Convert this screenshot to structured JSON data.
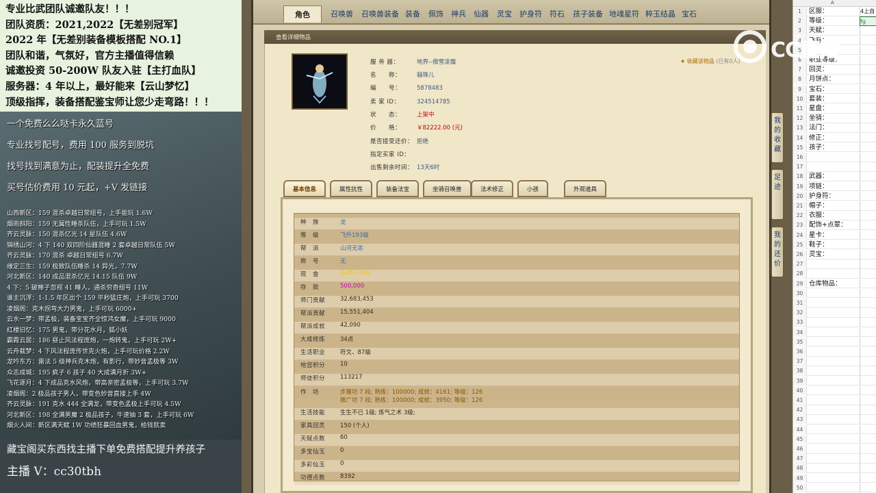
{
  "left_overlay": {
    "top_lines": [
      "专业比武团队诚邀队友！！！",
      "团队资质：2021,2022【无差别冠军】",
      "2022 年【无差别装备模板搭配 NO.1】",
      "团队和谐，气氛好，官方主播值得信赖",
      "诚邀投资 50-200W 队友入驻【主打血队】",
      "服务器：4 年以上，最好能来【云山梦忆】",
      "顶级指挥，装备搭配鉴宝师让您少走弯路！！！"
    ],
    "service_lines": [
      "一个免费么么哒卡永久蓝号",
      "专业找号配号，费用 100 服务到脱坑",
      "找号找到满意为止，配装提升全免费",
      "买号估价费用 10 元起，+V 发链接"
    ],
    "list_lines": [
      "山西新区：159 混杀卓越日常组号，上手能玩 1.6W",
      "烟雨斜阳：159 无属性睡杀队伍，上手可玩 1.5W",
      "齐云灵脉：150 混杀亿光 14 星队伍 4.6W",
      "锦绣山河：4 下 140 双四阶仙器混睡 2 套卓越日常队伍 5W",
      "齐云灵脉：170 混杀 卓越日常组号 6.7W",
      "缘定三生：159 极致队伍睡杀 14 异光，7.7W",
      "河北新区：140 成品混杀亿光 14.15 队伍 9W",
      "4 下：5 破棒子忽视 41 睡人，通杀穷奇组号 11W",
      "谁主沉浮：1-1.5 年区出个 159 平秒猛庄炮，上手可玩 3700",
      "凌烟阁：克木拐弯大力男鬼，上手可玩 6000+",
      "云水一梦：带孟极，装备宝宝齐全惊鸿女魔，上手可玩 9000",
      "红楼旧忆：175 男鬼，带分花水月，狐小妖",
      "霸霞云居：186 昼止风法程庞炮，一炮转鬼，上手可玩 2W+",
      "云舟载梦：4 下风法程庞传世克火炮，上手可玩价格 2.2W",
      "龙吟东方：雷法 5 级神兵克木炮，有影行，带妙音孟极等 3W",
      "众志成城：195 疯子 6 孩子 40 大成满月折 3W+",
      "飞花逐月：4 下成品克水风炮，带高亲密孟极等，上手可玩 3.7W",
      "凌烟阁：2 极品孩子男人，带变色妙音直接上手 4W",
      "齐云灵脉：191 克水 444 全满龙，带变色孟极上手可玩 4.5W",
      "河北新区：198 全满男魔 2 极品孩子，牛速抽 3 套，上手可玩 6W",
      "烟火人间：新区满天赋 1W 功绩狂暴回血男鬼，给钱就卖"
    ],
    "bottom_line": "藏宝阁买东西找主播下单免费搭配提升养孩子",
    "anchor_line": "主播 V：cc30tbh"
  },
  "game": {
    "tabs": [
      "角色",
      "召唤兽",
      "召唤兽装备",
      "装备",
      "佩饰",
      "神兵",
      "仙器",
      "灵宝",
      "护身符",
      "符石",
      "孩子装备",
      "地魂星符",
      "粹玉结晶",
      "宝石"
    ],
    "active_tab": "角色",
    "section_title": "查看详细物品",
    "favorite_label": "收藏该物品",
    "favorite_count": "(已有0人)",
    "item_info": [
      {
        "key": "服 务 器：",
        "value": "地界--傲雪凌霜"
      },
      {
        "key": "名　　称：",
        "value": "骊珠儿"
      },
      {
        "key": "编　　号：",
        "value": "5878483"
      },
      {
        "key": "卖 家 ID：",
        "value": "324514785"
      },
      {
        "key": "状　　态：",
        "value": "上架中"
      },
      {
        "key": "价　　格：",
        "value": "￥82222.00 (元)"
      },
      {
        "key": "是否接受还价：",
        "value": "拒绝"
      },
      {
        "key": "指定买家 ID：",
        "value": ""
      },
      {
        "key": "出售剩余时间：",
        "value": "13天6时"
      }
    ],
    "info_tabs": [
      "基本信息",
      "属性抗性",
      "装备法宝",
      "坐骑召唤兽",
      "法术修正",
      "小孩",
      "外观道具"
    ],
    "active_info_tab": "基本信息",
    "details": [
      {
        "key": "种　族",
        "value": "龙",
        "color": "#3a6fa0"
      },
      {
        "key": "等　级",
        "value": "飞升193级",
        "color": "#3a6fa0"
      },
      {
        "key": "帮　派",
        "value": "山河无恙",
        "color": "#3a6fa0"
      },
      {
        "key": "称　号",
        "value": "无",
        "color": "#3a6fa0"
      },
      {
        "key": "现　金",
        "value": "2,457,646",
        "color": "#f5c400"
      },
      {
        "key": "存　款",
        "value": "500,000",
        "color": "#d000b0"
      },
      {
        "key": "师门贡献",
        "value": "32,683,453",
        "color": "#3a2a14"
      },
      {
        "key": "帮派贡献",
        "value": "15,551,404",
        "color": "#3a2a14"
      },
      {
        "key": "帮派成就",
        "value": "42,090",
        "color": "#3a2a14"
      },
      {
        "key": "大成修炼",
        "value": "34点",
        "color": "#3a2a14"
      },
      {
        "key": "生活职业",
        "value": "符文、87级",
        "color": "#3a2a14"
      },
      {
        "key": "地宫积分",
        "value": "10",
        "color": "#3a2a14"
      },
      {
        "key": "师徒积分",
        "value": "113217",
        "color": "#3a2a14"
      },
      {
        "key": "生活技能",
        "value": "生生不已 1级; 炼气之术 3级;",
        "color": "#3a2a14"
      },
      {
        "key": "家具回灵",
        "value": "150 (个人)",
        "color": "#3a2a14"
      },
      {
        "key": "天赋点数",
        "value": "60",
        "color": "#3a2a14"
      },
      {
        "key": "多宝仙玉",
        "value": "0",
        "color": "#3a2a14"
      },
      {
        "key": "多彩仙玉",
        "value": "0",
        "color": "#3a2a14"
      },
      {
        "key": "功德点数",
        "value": "8392",
        "color": "#3a2a14"
      }
    ],
    "workshop_key": "作　坊",
    "workshop_lines": [
      "步履坊 7 段; 熟练：100000; 成就：4161; 等级：126",
      "推广坊 7 段; 熟练：100000; 成就：3950; 等级：126"
    ],
    "side_buttons": [
      "我的收藏",
      "足迹",
      "我的还价"
    ]
  },
  "logo": {
    "text": "CC直播"
  },
  "sheet": {
    "column": "A",
    "rows": [
      {
        "n": "1",
        "t": "区服：",
        "c2": "4上自"
      },
      {
        "n": "2",
        "t": "等级：",
        "c2": "fg"
      },
      {
        "n": "3",
        "t": "天赋：",
        "c2": ""
      },
      {
        "n": "4",
        "t": "飞升：",
        "c2": ""
      },
      {
        "n": "5",
        "t": "",
        "c2": ""
      },
      {
        "n": "6",
        "t": "职业等级：",
        "c2": ""
      },
      {
        "n": "7",
        "t": "回灵：",
        "c2": ""
      },
      {
        "n": "8",
        "t": "月饼点：",
        "c2": ""
      },
      {
        "n": "9",
        "t": "宝石：",
        "c2": ""
      },
      {
        "n": "10",
        "t": "套装：",
        "c2": ""
      },
      {
        "n": "11",
        "t": "星盘：",
        "c2": ""
      },
      {
        "n": "12",
        "t": "坐骑：",
        "c2": ""
      },
      {
        "n": "13",
        "t": "法门：",
        "c2": ""
      },
      {
        "n": "14",
        "t": "修正：",
        "c2": ""
      },
      {
        "n": "15",
        "t": "孩子：",
        "c2": ""
      },
      {
        "n": "16",
        "t": "",
        "c2": ""
      },
      {
        "n": "17",
        "t": "",
        "c2": ""
      },
      {
        "n": "18",
        "t": "武器：",
        "c2": ""
      },
      {
        "n": "19",
        "t": "项链：",
        "c2": ""
      },
      {
        "n": "20",
        "t": "护身符：",
        "c2": ""
      },
      {
        "n": "21",
        "t": "帽子：",
        "c2": ""
      },
      {
        "n": "22",
        "t": "衣服：",
        "c2": ""
      },
      {
        "n": "23",
        "t": "配饰+点翠：",
        "c2": ""
      },
      {
        "n": "24",
        "t": "星卡：",
        "c2": ""
      },
      {
        "n": "25",
        "t": "鞋子：",
        "c2": ""
      },
      {
        "n": "26",
        "t": "灵宝：",
        "c2": ""
      },
      {
        "n": "27",
        "t": "",
        "c2": ""
      },
      {
        "n": "28",
        "t": "",
        "c2": ""
      },
      {
        "n": "29",
        "t": "仓库物品：",
        "c2": ""
      },
      {
        "n": "30",
        "t": "",
        "c2": ""
      },
      {
        "n": "31",
        "t": "",
        "c2": ""
      },
      {
        "n": "32",
        "t": "",
        "c2": ""
      },
      {
        "n": "33",
        "t": "",
        "c2": ""
      },
      {
        "n": "34",
        "t": "",
        "c2": ""
      },
      {
        "n": "35",
        "t": "",
        "c2": ""
      },
      {
        "n": "36",
        "t": "",
        "c2": ""
      },
      {
        "n": "37",
        "t": "",
        "c2": ""
      },
      {
        "n": "38",
        "t": "",
        "c2": ""
      },
      {
        "n": "39",
        "t": "",
        "c2": ""
      },
      {
        "n": "40",
        "t": "",
        "c2": ""
      },
      {
        "n": "41",
        "t": "",
        "c2": ""
      },
      {
        "n": "42",
        "t": "",
        "c2": ""
      },
      {
        "n": "43",
        "t": "",
        "c2": ""
      },
      {
        "n": "44",
        "t": "",
        "c2": ""
      },
      {
        "n": "45",
        "t": "",
        "c2": ""
      },
      {
        "n": "46",
        "t": "",
        "c2": ""
      },
      {
        "n": "47",
        "t": "",
        "c2": ""
      },
      {
        "n": "48",
        "t": "",
        "c2": ""
      },
      {
        "n": "49",
        "t": "",
        "c2": ""
      },
      {
        "n": "50",
        "t": "",
        "c2": ""
      }
    ]
  },
  "colors": {
    "price_red": "#c80000",
    "link_blue": "#3b5a84",
    "sheet_select": "#1e7b34"
  }
}
